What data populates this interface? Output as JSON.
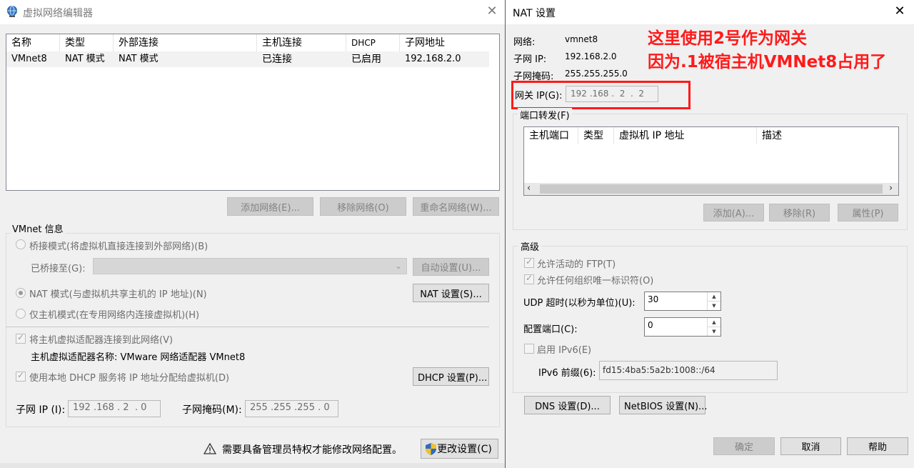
{
  "left_window": {
    "title": "虚拟网络编辑器",
    "close_glyph": "✕",
    "table": {
      "headers": [
        "名称",
        "类型",
        "外部连接",
        "主机连接",
        "DHCP",
        "子网地址"
      ],
      "rows": [
        [
          "VMnet8",
          "NAT 模式",
          "NAT 模式",
          "已连接",
          "已启用",
          "192.168.2.0"
        ]
      ]
    },
    "buttons": {
      "add_network": "添加网络(E)...",
      "remove_network": "移除网络(O)",
      "rename_network": "重命名网络(W)..."
    },
    "vmnet_info": {
      "title": "VMnet 信息",
      "bridge_mode": "桥接模式(将虚拟机直接连接到外部网络)(B)",
      "bridged_to_label": "已桥接至(G):",
      "bridged_to_value": "",
      "auto_settings": "自动设置(U)...",
      "nat_mode": "NAT 模式(与虚拟机共享主机的 IP 地址)(N)",
      "nat_settings": "NAT 设置(S)...",
      "host_only_mode": "仅主机模式(在专用网络内连接虚拟机)(H)",
      "connect_adapter": "将主机虚拟适配器连接到此网络(V)",
      "adapter_name": "主机虚拟适配器名称: VMware 网络适配器 VMnet8",
      "use_dhcp": "使用本地 DHCP 服务将 IP 地址分配给虚拟机(D)",
      "dhcp_settings": "DHCP 设置(P)...",
      "subnet_ip_label": "子网 IP (I):",
      "subnet_ip_value": "192 .168 . 2  . 0",
      "subnet_mask_label": "子网掩码(M):",
      "subnet_mask_value": "255 .255 .255 . 0"
    },
    "admin_notice": "需要具备管理员特权才能修改网络配置。",
    "change_settings": "更改设置(C)"
  },
  "nat_window": {
    "title": "NAT 设置",
    "close_glyph": "✕",
    "network_label": "网络:",
    "network_value": "vmnet8",
    "subnet_ip_label": "子网 IP:",
    "subnet_ip_value": "192.168.2.0",
    "subnet_mask_label": "子网掩码:",
    "subnet_mask_value": "255.255.255.0",
    "gateway_label": "网关 IP(G):",
    "gateway_value": "192 .168 .  2  .  2",
    "annotation_line1": "这里使用2号作为网关",
    "annotation_line2": "因为.1被宿主机VMNet8占用了",
    "port_forwarding": {
      "title": "端口转发(F)",
      "headers": [
        "主机端口",
        "类型",
        "虚拟机 IP 地址",
        "描述"
      ],
      "add": "添加(A)...",
      "remove": "移除(R)",
      "properties": "属性(P)"
    },
    "advanced": {
      "title": "高级",
      "allow_ftp": "允许活动的 FTP(T)",
      "allow_oui": "允许任何组织唯一标识符(O)",
      "udp_timeout_label": "UDP 超时(以秒为单位)(U):",
      "udp_timeout_value": "30",
      "config_port_label": "配置端口(C):",
      "config_port_value": "0",
      "enable_ipv6": "启用 IPv6(E)",
      "ipv6_prefix_label": "IPv6 前缀(6):",
      "ipv6_prefix_value": "fd15:4ba5:5a2b:1008::/64"
    },
    "dns_settings": "DNS 设置(D)...",
    "netbios_settings": "NetBIOS 设置(N)...",
    "ok": "确定",
    "cancel": "取消",
    "help": "帮助"
  },
  "colors": {
    "annotation_red": "#ff1a1a",
    "window_bg": "#f0f0f0"
  }
}
